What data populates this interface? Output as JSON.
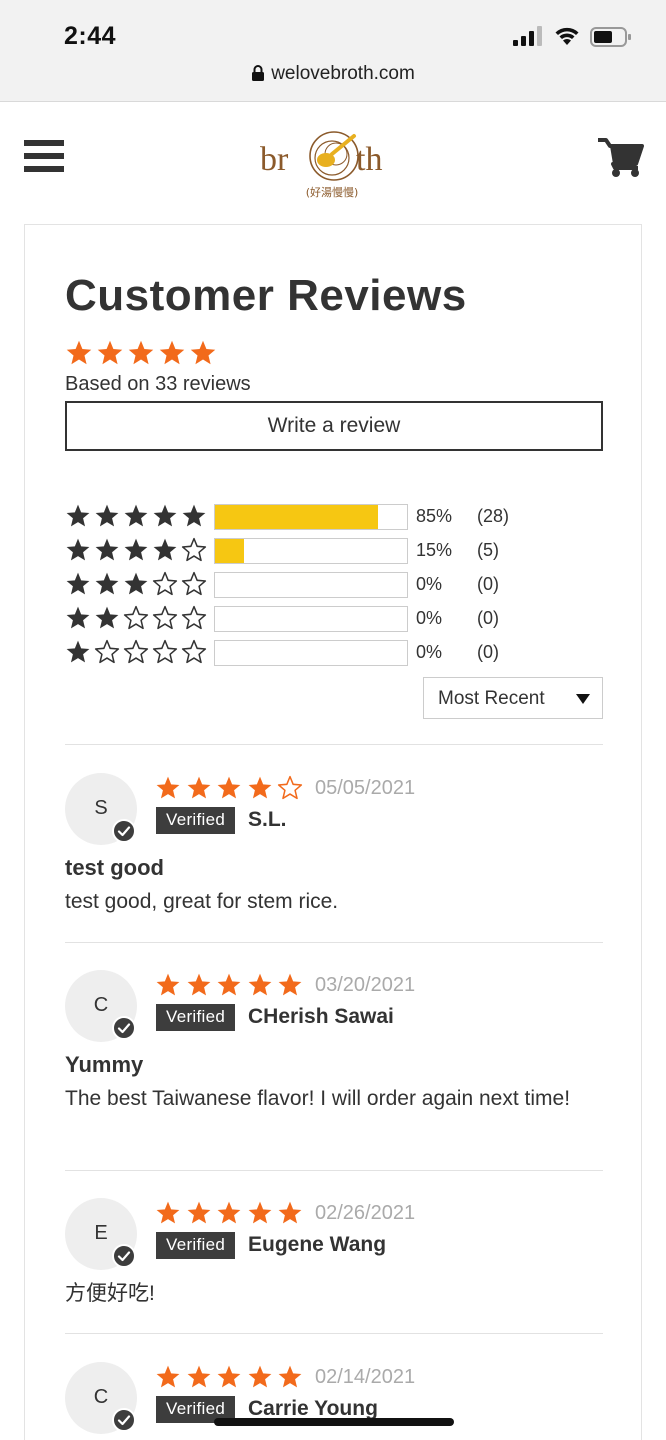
{
  "status_bar": {
    "time": "2:44",
    "url": "welovebroth.com",
    "icons": [
      "cellular-signal-icon",
      "wifi-icon",
      "battery-icon",
      "lock-icon"
    ]
  },
  "header": {
    "logo_text": "broth",
    "logo_subtext": "(好湯慢慢)",
    "icons": [
      "hamburger-menu-icon",
      "shopping-cart-icon"
    ]
  },
  "reviews": {
    "title": "Customer Reviews",
    "average_rating": 5,
    "summary": "Based on 33 reviews",
    "write_review_label": "Write a review",
    "histogram": [
      {
        "stars": 5,
        "percent": 85,
        "percent_label": "85%",
        "count_label": "(28)"
      },
      {
        "stars": 4,
        "percent": 15,
        "percent_label": "15%",
        "count_label": "(5)"
      },
      {
        "stars": 3,
        "percent": 0,
        "percent_label": "0%",
        "count_label": "(0)"
      },
      {
        "stars": 2,
        "percent": 0,
        "percent_label": "0%",
        "count_label": "(0)"
      },
      {
        "stars": 1,
        "percent": 0,
        "percent_label": "0%",
        "count_label": "(0)"
      }
    ],
    "sort_label": "Most Recent",
    "items": [
      {
        "initial": "S",
        "rating": 4,
        "date": "05/05/2021",
        "badge": "Verified",
        "name": "S.L.",
        "title": "test good",
        "body": "test good, great for stem rice."
      },
      {
        "initial": "C",
        "rating": 5,
        "date": "03/20/2021",
        "badge": "Verified",
        "name": "CHerish Sawai",
        "title": "Yummy",
        "body": "The best Taiwanese flavor! I will order again next time!"
      },
      {
        "initial": "E",
        "rating": 5,
        "date": "02/26/2021",
        "badge": "Verified",
        "name": "Eugene Wang",
        "title": "",
        "body": "方便好吃!"
      },
      {
        "initial": "C",
        "rating": 5,
        "date": "02/14/2021",
        "badge": "Verified",
        "name": "Carrie Young",
        "title": "",
        "body": ""
      }
    ]
  },
  "colors": {
    "rating_star": "#f26a1b",
    "histogram_star": "#333333",
    "bar_fill": "#f6c712",
    "logo_brown": "#8b5a2b",
    "logo_gold": "#e8b020"
  }
}
